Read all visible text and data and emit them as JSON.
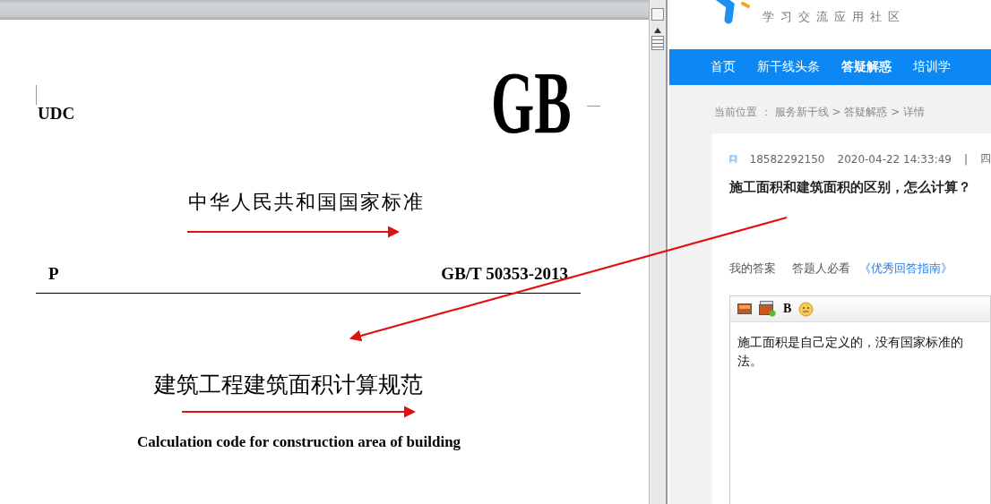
{
  "document": {
    "corner_label": "UDC",
    "logo": "GB",
    "title": "中华人民共和国国家标准",
    "category": "P",
    "standard_number": "GB/T 50353-2013",
    "name": "建筑工程建筑面积计算规范",
    "english_name": "Calculation code for construction area of building"
  },
  "site": {
    "tagline": "学习交流应用社区",
    "nav": [
      {
        "label": "首页",
        "selected": false
      },
      {
        "label": "新干线头条",
        "selected": false
      },
      {
        "label": "答疑解惑",
        "selected": true
      },
      {
        "label": "培训学",
        "selected": false
      }
    ],
    "breadcrumb": "当前位置 ： 服务新干线 > 答疑解惑 > 详情",
    "question": {
      "user": "18582292150",
      "time": "2020-04-22 14:33:49",
      "separator": "|",
      "location": "四",
      "title": "施工面积和建筑面积的区别，怎么计算？"
    },
    "answer": {
      "tabs": [
        "我的答案",
        "答题人必看"
      ],
      "guide_link": "《优秀回答指南》",
      "bold_button": "B",
      "lines": [
        "施工面积是自己定义的，没有国家标准的",
        "法。"
      ]
    }
  }
}
